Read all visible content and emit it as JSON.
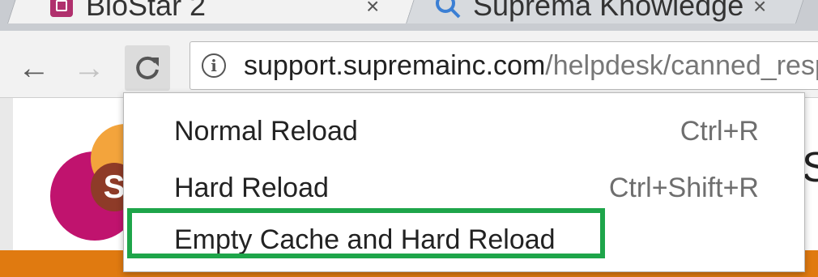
{
  "tabs": [
    {
      "title": "BioStar 2",
      "icon": "biostar-favicon",
      "close_label": "×"
    },
    {
      "title": "Suprema Knowledge",
      "icon": "search-favicon",
      "close_label": "×"
    }
  ],
  "toolbar": {
    "back_icon": "←",
    "forward_icon": "→",
    "reload_icon": "C"
  },
  "omnibox": {
    "info_icon": "i",
    "url_host": "support.supremainc.com",
    "url_path": "/helpdesk/canned_resp"
  },
  "page": {
    "logo_letter": "S",
    "heading_letter": "S"
  },
  "reload_menu": {
    "items": [
      {
        "label": "Normal Reload",
        "shortcut": "Ctrl+R"
      },
      {
        "label": "Hard Reload",
        "shortcut": "Ctrl+Shift+R"
      },
      {
        "label": "Empty Cache and Hard Reload",
        "shortcut": ""
      }
    ],
    "highlight_color": "#1ea54a"
  },
  "colors": {
    "accent_orange": "#e07a10",
    "logo_magenta": "#c0136e"
  }
}
